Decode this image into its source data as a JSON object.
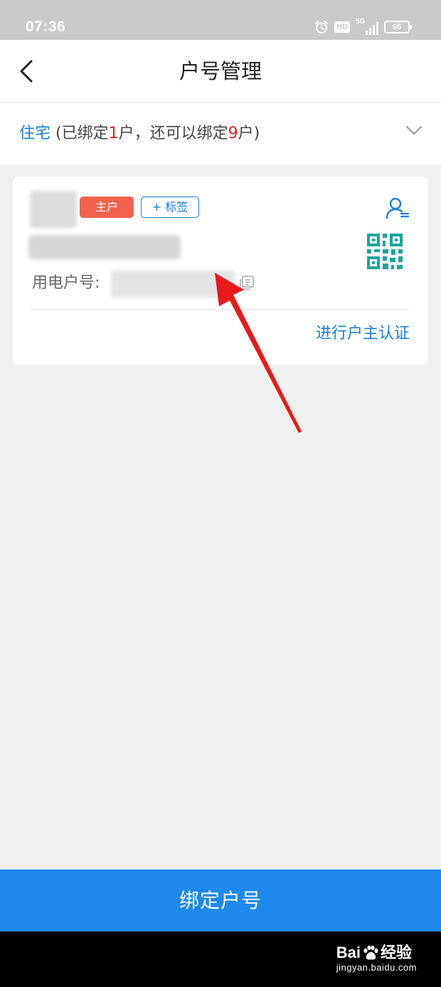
{
  "status_bar": {
    "time": "07:36",
    "hd_label": "HD",
    "network_label": "5G",
    "battery_level": "95"
  },
  "header": {
    "title": "户号管理"
  },
  "account_type": {
    "name": "住宅",
    "text_open": "(已绑定",
    "bound_count": "1",
    "text_mid": "户，还可以绑定",
    "remaining_count": "9",
    "text_close": "户)"
  },
  "account_card": {
    "owner_badge": "主户",
    "tag_button": "+ 标签",
    "account_number_label": "用电户号:",
    "verify_link": "进行户主认证"
  },
  "bottom": {
    "bind_button": "绑定户号"
  },
  "watermark": {
    "brand": "Bai",
    "brand_suffix": "经验",
    "url": "jingyan.baidu.com"
  },
  "colors": {
    "accent_blue": "#1a7fd4",
    "button_blue": "#1e88ec",
    "count_red": "#e02020",
    "badge_orange": "#f0624c",
    "qr_teal": "#17a59a",
    "arrow_red": "#e8191d"
  },
  "icons": [
    "back-arrow-icon",
    "alarm-icon",
    "chevron-down-icon",
    "user-profile-icon",
    "qr-code-icon",
    "copy-icon",
    "paw-icon"
  ]
}
